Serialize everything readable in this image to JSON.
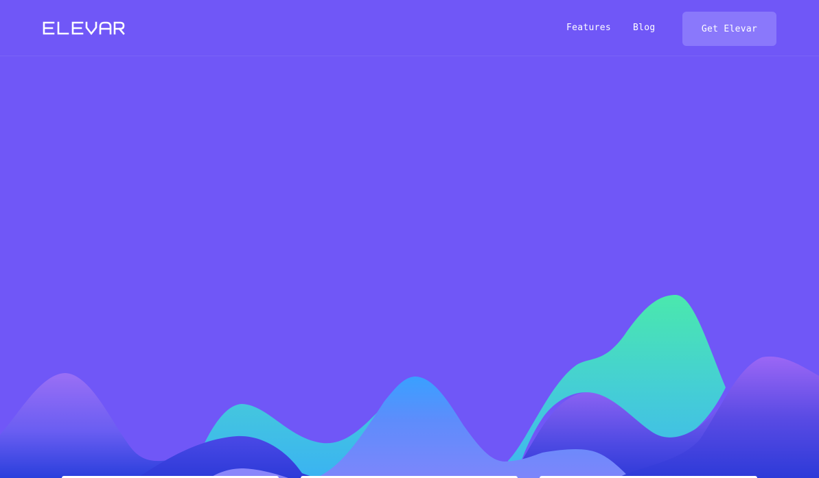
{
  "brand": {
    "name": "ELEVAR",
    "background_color": "#7057f7",
    "cta_color": "#8a78fb"
  },
  "nav": {
    "features_label": "Features",
    "blog_label": "Blog",
    "cta_label": "Get Elevar"
  },
  "hero": {
    "illustration": "layered-mountain-waves",
    "colors": {
      "left_hill": "#9a6ff5",
      "deep_blue": "#2e40dc",
      "cyan": "#3fc8e6",
      "green": "#47e6b0",
      "sky_blue": "#3aa0ff",
      "lavender": "#7d86fb",
      "right_hill": "#9b67f5"
    }
  },
  "cards": {
    "count": 3
  }
}
